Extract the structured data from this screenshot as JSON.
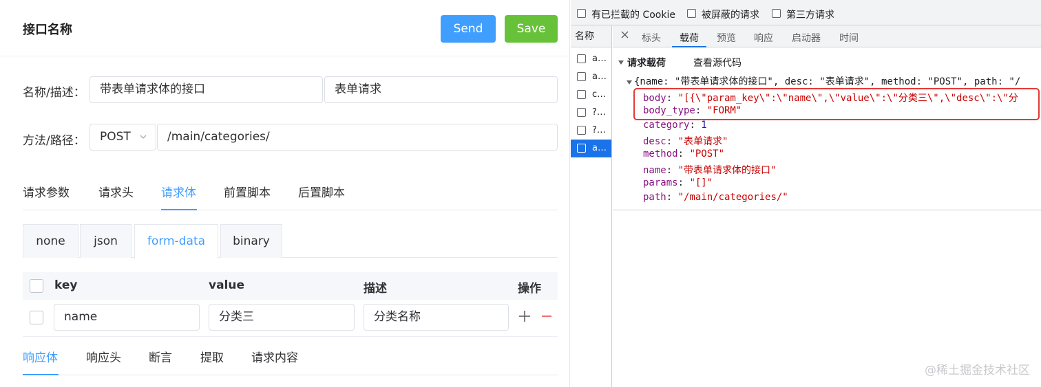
{
  "header": {
    "title": "接口名称",
    "send_label": "Send",
    "save_label": "Save"
  },
  "form": {
    "name_label": "名称/描述：",
    "name_value": "带表单请求体的接口",
    "desc_value": "表单请求",
    "method_label": "方法/路径：",
    "method_value": "POST",
    "path_value": "/main/categories/"
  },
  "request_tabs": [
    "请求参数",
    "请求头",
    "请求体",
    "前置脚本",
    "后置脚本"
  ],
  "request_tabs_active": "请求体",
  "body_types": [
    "none",
    "json",
    "form-data",
    "binary"
  ],
  "body_type_active": "form-data",
  "table": {
    "headers": {
      "key": "key",
      "value": "value",
      "desc": "描述",
      "op": "操作"
    },
    "rows": [
      {
        "key": "name",
        "value": "分类三",
        "desc": "分类名称"
      }
    ],
    "add_icon": "plus-icon",
    "remove_icon": "minus-icon"
  },
  "response_tabs": [
    "响应体",
    "响应头",
    "断言",
    "提取",
    "请求内容"
  ],
  "response_tabs_active": "响应体",
  "devtools": {
    "filters": [
      "有已拦截的 Cookie",
      "被屏蔽的请求",
      "第三方请求"
    ],
    "name_header": "名称",
    "requests": [
      "a…",
      "a…",
      "c…",
      "?…",
      "?…",
      "a…"
    ],
    "selected_request_index": 5,
    "close_icon": "close-icon",
    "tabs": [
      "标头",
      "载荷",
      "预览",
      "响应",
      "启动器",
      "时间"
    ],
    "active_tab": "载荷",
    "payload_section_title": "请求载荷",
    "view_source": "查看源代码",
    "object_summary": "{name: \"带表单请求体的接口\", desc: \"表单请求\", method: \"POST\", path: \"/",
    "properties": [
      {
        "key": "body",
        "value": "\"[{\\\"param_key\\\":\\\"name\\\",\\\"value\\\":\\\"分类三\\\",\\\"desc\\\":\\\"分",
        "kind": "string",
        "highlighted": true
      },
      {
        "key": "body_type",
        "value": "\"FORM\"",
        "kind": "string",
        "highlighted": true
      },
      {
        "key": "category",
        "value": "1",
        "kind": "number",
        "highlighted": false
      },
      {
        "key": "desc",
        "value": "\"表单请求\"",
        "kind": "string",
        "highlighted": false
      },
      {
        "key": "method",
        "value": "\"POST\"",
        "kind": "string",
        "highlighted": false
      },
      {
        "key": "name",
        "value": "\"带表单请求体的接口\"",
        "kind": "string",
        "highlighted": false
      },
      {
        "key": "params",
        "value": "\"[]\"",
        "kind": "string",
        "highlighted": false
      },
      {
        "key": "path",
        "value": "\"/main/categories/\"",
        "kind": "string",
        "highlighted": false
      }
    ],
    "highlight_color": "#e53935"
  },
  "watermark": "@稀土掘金技术社区",
  "colors": {
    "primary": "#409eff",
    "success": "#67c23a",
    "danger": "#f56c6c",
    "devtools_selected": "#1a73e8"
  }
}
